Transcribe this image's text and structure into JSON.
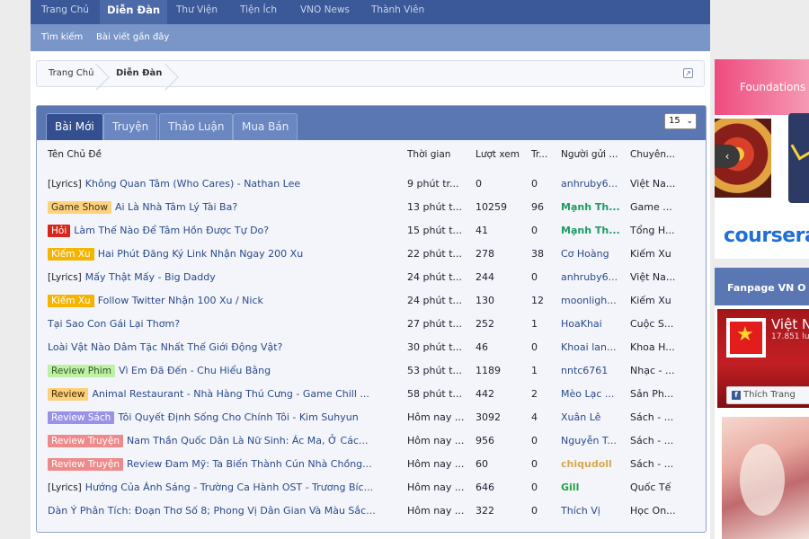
{
  "topnav": {
    "items": [
      "Trang Chủ",
      "Diễn Đàn",
      "Thư Viện",
      "Tiện Ích",
      "VNO News",
      "Thành Viên"
    ],
    "active": "Diễn Đàn"
  },
  "subnav": {
    "items": [
      "Tìm kiếm",
      "Bài viết gần đây"
    ]
  },
  "breadcrumb": {
    "items": [
      "Trang Chủ",
      "Diễn Đàn"
    ]
  },
  "tabs": [
    "Bài Mới",
    "Truyện",
    "Thảo Luận",
    "Mua Bán"
  ],
  "per_page": "15",
  "columns": [
    "Tên Chủ Đề",
    "Thời gian",
    "Lượt xem",
    "Tr...",
    "Người gửi ...",
    "Chuyên..."
  ],
  "rows": [
    {
      "prefix": "[Lyrics]",
      "prefix_style": "lyrics",
      "title": "Không Quan Tâm (Who Cares) - Nathan Lee",
      "time": "9 phút tr...",
      "views": "0",
      "replies": "0",
      "user": "anhruby6...",
      "user_style": "",
      "cat": "Việt Na..."
    },
    {
      "prefix": "Game Show",
      "prefix_style": "gameshow",
      "title": "Ai Là Nhà Tâm Lý Tài Ba?",
      "time": "13 phút t...",
      "views": "10259",
      "replies": "96",
      "user": "Mạnh Th...",
      "user_style": "green",
      "cat": "Game ..."
    },
    {
      "prefix": "Hỏi",
      "prefix_style": "hoi",
      "title": "Làm Thế Nào Để Tâm Hồn Được Tự Do?",
      "time": "15 phút t...",
      "views": "41",
      "replies": "0",
      "user": "Mạnh Th...",
      "user_style": "green",
      "cat": "Tổng H..."
    },
    {
      "prefix": "Kiếm Xu",
      "prefix_style": "kiemxu",
      "title": "Hai Phút Đăng Ký Link Nhận Ngay 200 Xu",
      "time": "22 phút t...",
      "views": "278",
      "replies": "38",
      "user": "Cơ Hoàng",
      "user_style": "",
      "cat": "Kiếm Xu"
    },
    {
      "prefix": "[Lyrics]",
      "prefix_style": "lyrics",
      "title": "Mấy Thật Mấy - Big Daddy",
      "time": "24 phút t...",
      "views": "244",
      "replies": "0",
      "user": "anhruby6...",
      "user_style": "",
      "cat": "Việt Na..."
    },
    {
      "prefix": "Kiếm Xu",
      "prefix_style": "kiemxu",
      "title": "Follow Twitter Nhận 100 Xu / Nick",
      "time": "24 phút t...",
      "views": "130",
      "replies": "12",
      "user": "moonligh...",
      "user_style": "",
      "cat": "Kiếm Xu"
    },
    {
      "prefix": "",
      "prefix_style": "",
      "title": "Tại Sao Con Gái Lại Thơm?",
      "time": "27 phút t...",
      "views": "252",
      "replies": "1",
      "user": "HoaKhai",
      "user_style": "",
      "cat": "Cuộc S..."
    },
    {
      "prefix": "",
      "prefix_style": "",
      "title": "Loài Vật Nào Dâm Tặc Nhất Thế Giới Động Vật?",
      "time": "30 phút t...",
      "views": "46",
      "replies": "0",
      "user": "Khoai lan...",
      "user_style": "",
      "cat": "Khoa H..."
    },
    {
      "prefix": "Review Phim",
      "prefix_style": "reviewphim",
      "title": "Vì Em Đã Đến - Chu Hiểu Bằng",
      "time": "53 phút t...",
      "views": "1189",
      "replies": "1",
      "user": "nntc6761",
      "user_style": "",
      "cat": "Nhạc - ..."
    },
    {
      "prefix": "Review",
      "prefix_style": "review",
      "title": "Animal Restaurant - Nhà Hàng Thú Cưng - Game Chill ...",
      "time": "58 phút t...",
      "views": "442",
      "replies": "2",
      "user": "Mèo Lạc ...",
      "user_style": "",
      "cat": "Sản Ph..."
    },
    {
      "prefix": "Review Sách",
      "prefix_style": "reviewsach",
      "title": "Tôi Quyết Định Sống Cho Chính Tôi - Kim Suhyun",
      "time": "Hôm nay ...",
      "views": "3092",
      "replies": "4",
      "user": "Xuân Lê",
      "user_style": "",
      "cat": "Sách - ..."
    },
    {
      "prefix": "Review Truyện",
      "prefix_style": "reviewtruyen",
      "title": "Nam Thần Quốc Dân Là Nữ Sinh: Ác Ma, Ở Các...",
      "time": "Hôm nay ...",
      "views": "956",
      "replies": "0",
      "user": "Nguyễn T...",
      "user_style": "",
      "cat": "Sách - ..."
    },
    {
      "prefix": "Review Truyện",
      "prefix_style": "reviewtruyen",
      "title": "Review Đam Mỹ: Ta Biến Thành Cún Nhà Chồng...",
      "time": "Hôm nay ...",
      "views": "60",
      "replies": "0",
      "user": "chiqudoll",
      "user_style": "orange",
      "cat": "Sách - ..."
    },
    {
      "prefix": "[Lyrics]",
      "prefix_style": "lyrics",
      "title": "Hướng Của Ánh Sáng - Trường Ca Hành OST - Trương Bíc...",
      "time": "Hôm nay ...",
      "views": "646",
      "replies": "0",
      "user": "Gill",
      "user_style": "gillg",
      "cat": "Quốc Tế"
    },
    {
      "prefix": "",
      "prefix_style": "",
      "title": "Dàn Ý Phân Tích: Đoạn Thơ Số 8; Phong Vị Dân Gian Và Màu Sắc...",
      "time": "Hôm nay ...",
      "views": "322",
      "replies": "0",
      "user": "Thích Vị",
      "user_style": "",
      "cat": "Học On..."
    }
  ],
  "sidebar": {
    "ad": {
      "title": "Foundations",
      "brand": "coursera"
    },
    "fanpage": {
      "title": "Fanpage VN O",
      "name": "Việt N",
      "likes": "17.851 lư",
      "like_button": "Thích Trang"
    }
  }
}
